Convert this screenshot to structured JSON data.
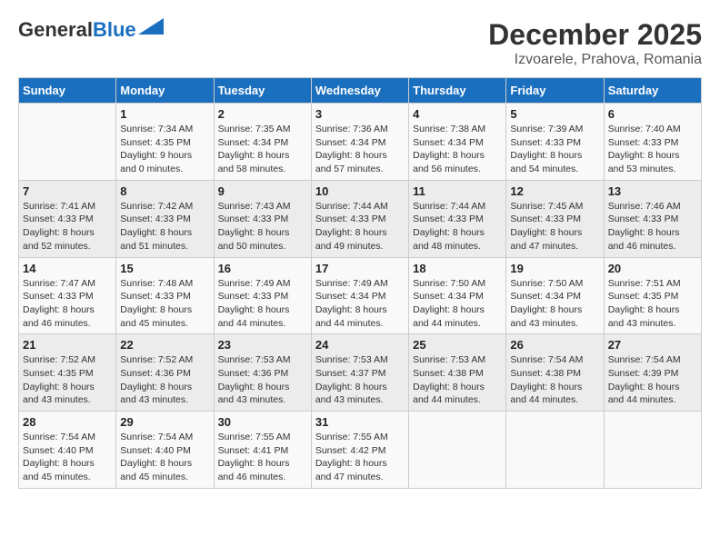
{
  "header": {
    "logo_general": "General",
    "logo_blue": "Blue",
    "title": "December 2025",
    "subtitle": "Izvoarele, Prahova, Romania"
  },
  "days_of_week": [
    "Sunday",
    "Monday",
    "Tuesday",
    "Wednesday",
    "Thursday",
    "Friday",
    "Saturday"
  ],
  "weeks": [
    [
      {
        "day": "",
        "info": ""
      },
      {
        "day": "1",
        "info": "Sunrise: 7:34 AM\nSunset: 4:35 PM\nDaylight: 9 hours\nand 0 minutes."
      },
      {
        "day": "2",
        "info": "Sunrise: 7:35 AM\nSunset: 4:34 PM\nDaylight: 8 hours\nand 58 minutes."
      },
      {
        "day": "3",
        "info": "Sunrise: 7:36 AM\nSunset: 4:34 PM\nDaylight: 8 hours\nand 57 minutes."
      },
      {
        "day": "4",
        "info": "Sunrise: 7:38 AM\nSunset: 4:34 PM\nDaylight: 8 hours\nand 56 minutes."
      },
      {
        "day": "5",
        "info": "Sunrise: 7:39 AM\nSunset: 4:33 PM\nDaylight: 8 hours\nand 54 minutes."
      },
      {
        "day": "6",
        "info": "Sunrise: 7:40 AM\nSunset: 4:33 PM\nDaylight: 8 hours\nand 53 minutes."
      }
    ],
    [
      {
        "day": "7",
        "info": "Sunrise: 7:41 AM\nSunset: 4:33 PM\nDaylight: 8 hours\nand 52 minutes."
      },
      {
        "day": "8",
        "info": "Sunrise: 7:42 AM\nSunset: 4:33 PM\nDaylight: 8 hours\nand 51 minutes."
      },
      {
        "day": "9",
        "info": "Sunrise: 7:43 AM\nSunset: 4:33 PM\nDaylight: 8 hours\nand 50 minutes."
      },
      {
        "day": "10",
        "info": "Sunrise: 7:44 AM\nSunset: 4:33 PM\nDaylight: 8 hours\nand 49 minutes."
      },
      {
        "day": "11",
        "info": "Sunrise: 7:44 AM\nSunset: 4:33 PM\nDaylight: 8 hours\nand 48 minutes."
      },
      {
        "day": "12",
        "info": "Sunrise: 7:45 AM\nSunset: 4:33 PM\nDaylight: 8 hours\nand 47 minutes."
      },
      {
        "day": "13",
        "info": "Sunrise: 7:46 AM\nSunset: 4:33 PM\nDaylight: 8 hours\nand 46 minutes."
      }
    ],
    [
      {
        "day": "14",
        "info": "Sunrise: 7:47 AM\nSunset: 4:33 PM\nDaylight: 8 hours\nand 46 minutes."
      },
      {
        "day": "15",
        "info": "Sunrise: 7:48 AM\nSunset: 4:33 PM\nDaylight: 8 hours\nand 45 minutes."
      },
      {
        "day": "16",
        "info": "Sunrise: 7:49 AM\nSunset: 4:33 PM\nDaylight: 8 hours\nand 44 minutes."
      },
      {
        "day": "17",
        "info": "Sunrise: 7:49 AM\nSunset: 4:34 PM\nDaylight: 8 hours\nand 44 minutes."
      },
      {
        "day": "18",
        "info": "Sunrise: 7:50 AM\nSunset: 4:34 PM\nDaylight: 8 hours\nand 44 minutes."
      },
      {
        "day": "19",
        "info": "Sunrise: 7:50 AM\nSunset: 4:34 PM\nDaylight: 8 hours\nand 43 minutes."
      },
      {
        "day": "20",
        "info": "Sunrise: 7:51 AM\nSunset: 4:35 PM\nDaylight: 8 hours\nand 43 minutes."
      }
    ],
    [
      {
        "day": "21",
        "info": "Sunrise: 7:52 AM\nSunset: 4:35 PM\nDaylight: 8 hours\nand 43 minutes."
      },
      {
        "day": "22",
        "info": "Sunrise: 7:52 AM\nSunset: 4:36 PM\nDaylight: 8 hours\nand 43 minutes."
      },
      {
        "day": "23",
        "info": "Sunrise: 7:53 AM\nSunset: 4:36 PM\nDaylight: 8 hours\nand 43 minutes."
      },
      {
        "day": "24",
        "info": "Sunrise: 7:53 AM\nSunset: 4:37 PM\nDaylight: 8 hours\nand 43 minutes."
      },
      {
        "day": "25",
        "info": "Sunrise: 7:53 AM\nSunset: 4:38 PM\nDaylight: 8 hours\nand 44 minutes."
      },
      {
        "day": "26",
        "info": "Sunrise: 7:54 AM\nSunset: 4:38 PM\nDaylight: 8 hours\nand 44 minutes."
      },
      {
        "day": "27",
        "info": "Sunrise: 7:54 AM\nSunset: 4:39 PM\nDaylight: 8 hours\nand 44 minutes."
      }
    ],
    [
      {
        "day": "28",
        "info": "Sunrise: 7:54 AM\nSunset: 4:40 PM\nDaylight: 8 hours\nand 45 minutes."
      },
      {
        "day": "29",
        "info": "Sunrise: 7:54 AM\nSunset: 4:40 PM\nDaylight: 8 hours\nand 45 minutes."
      },
      {
        "day": "30",
        "info": "Sunrise: 7:55 AM\nSunset: 4:41 PM\nDaylight: 8 hours\nand 46 minutes."
      },
      {
        "day": "31",
        "info": "Sunrise: 7:55 AM\nSunset: 4:42 PM\nDaylight: 8 hours\nand 47 minutes."
      },
      {
        "day": "",
        "info": ""
      },
      {
        "day": "",
        "info": ""
      },
      {
        "day": "",
        "info": ""
      }
    ]
  ]
}
